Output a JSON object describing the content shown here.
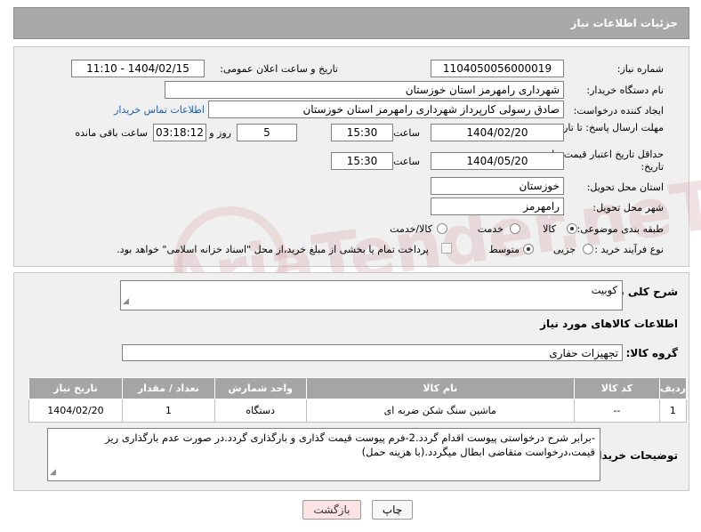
{
  "header": {
    "title": "جزئیات اطلاعات نیاز"
  },
  "form": {
    "need_number_label": "شماره نیاز:",
    "need_number": "1104050056000019",
    "announce_label": "تاریخ و ساعت اعلان عمومی:",
    "announce_value": "1404/02/15 - 11:10",
    "buyer_label": "نام دستگاه خریدار:",
    "buyer_value": "شهرداری رامهرمز استان خوزستان",
    "creator_label": "ایجاد کننده درخواست:",
    "creator_value": "صادق رسولی کارپرداز شهرداری رامهرمز استان خوزستان",
    "contact_link": "اطلاعات تماس خریدار",
    "deadline_label": "مهلت ارسال پاسخ: تا تاریخ:",
    "deadline_date": "1404/02/20",
    "time_label": "ساعت",
    "deadline_time": "15:30",
    "days_value": "5",
    "days_label": "روز و",
    "remaining_time": "03:18:12",
    "remaining_label": "ساعت باقی مانده",
    "validity_label": "حداقل تاریخ اعتبار قیمت: تا تاریخ:",
    "validity_date": "1404/05/20",
    "validity_time": "15:30",
    "province_label": "استان محل تحویل:",
    "province_value": "خوزستان",
    "city_label": "شهر محل تحویل:",
    "city_value": "رامهرمز",
    "category_label": "طبقه بندی موضوعی:",
    "category_options": [
      "کالا",
      "خدمت",
      "کالا/خدمت"
    ],
    "process_label": "نوع فرآیند خرید :",
    "process_options": [
      "جزیی",
      "متوسط"
    ],
    "payment_note": "پرداخت تمام یا بخشی از مبلغ خرید،از محل \"اسناد خزانه اسلامی\" خواهد بود."
  },
  "detail": {
    "desc_label": "شرح کلی نیاز:",
    "desc_value": "کوبیت",
    "items_title": "اطلاعات کالاهای مورد نیاز",
    "group_label": "گروه کالا:",
    "group_value": "تجهیزات حفاری",
    "table": {
      "headers": [
        "ردیف",
        "کد کالا",
        "نام کالا",
        "واحد شمارش",
        "تعداد / مقدار",
        "تاریخ نیاز"
      ],
      "rows": [
        [
          "1",
          "--",
          "ماشین سنگ شکن ضربه ای",
          "دستگاه",
          "1",
          "1404/02/20"
        ]
      ]
    },
    "notes_label": "توضیحات خریدار:",
    "notes_value": "-برابر شرح درخواستی پیوست اقدام گردد.2-فرم پیوست قیمت گذاری و بارگذاری گردد.در صورت عدم بارگذاری ریز قیمت،درخواست متقاضی ابطال میگردد.(با هزینه حمل)"
  },
  "buttons": {
    "print": "چاپ",
    "back": "بازگشت"
  },
  "watermark": {
    "text": "AriaTender.neT"
  },
  "colors": {
    "header_bg": "#a9a9a9",
    "table_header_bg": "#a5a5a5",
    "link": "#1a5fb4",
    "back_button_bg": "#fbe3e3"
  }
}
